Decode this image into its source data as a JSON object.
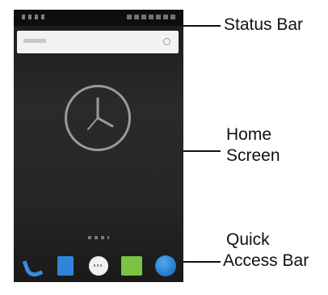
{
  "callouts": {
    "status_bar": "Status Bar",
    "home_screen_line1": "Home",
    "home_screen_line2": "Screen",
    "quick_access_line1": "Quick",
    "quick_access_line2": "Access Bar"
  },
  "phone": {
    "dock_icons": [
      "phone-icon",
      "contacts-icon",
      "messaging-icon",
      "chat-icon",
      "browser-icon"
    ],
    "colors": {
      "screen_bg": "#262626",
      "status_bar_bg": "#0e0e0e",
      "search_bar_bg": "#f2f2f2",
      "clock_ring": "#9b9b9b",
      "phone_icon": "#3a8de0",
      "contacts_icon": "#2f86d8",
      "chat_icon": "#7cc243",
      "browser_icon": "#2478c8"
    }
  }
}
